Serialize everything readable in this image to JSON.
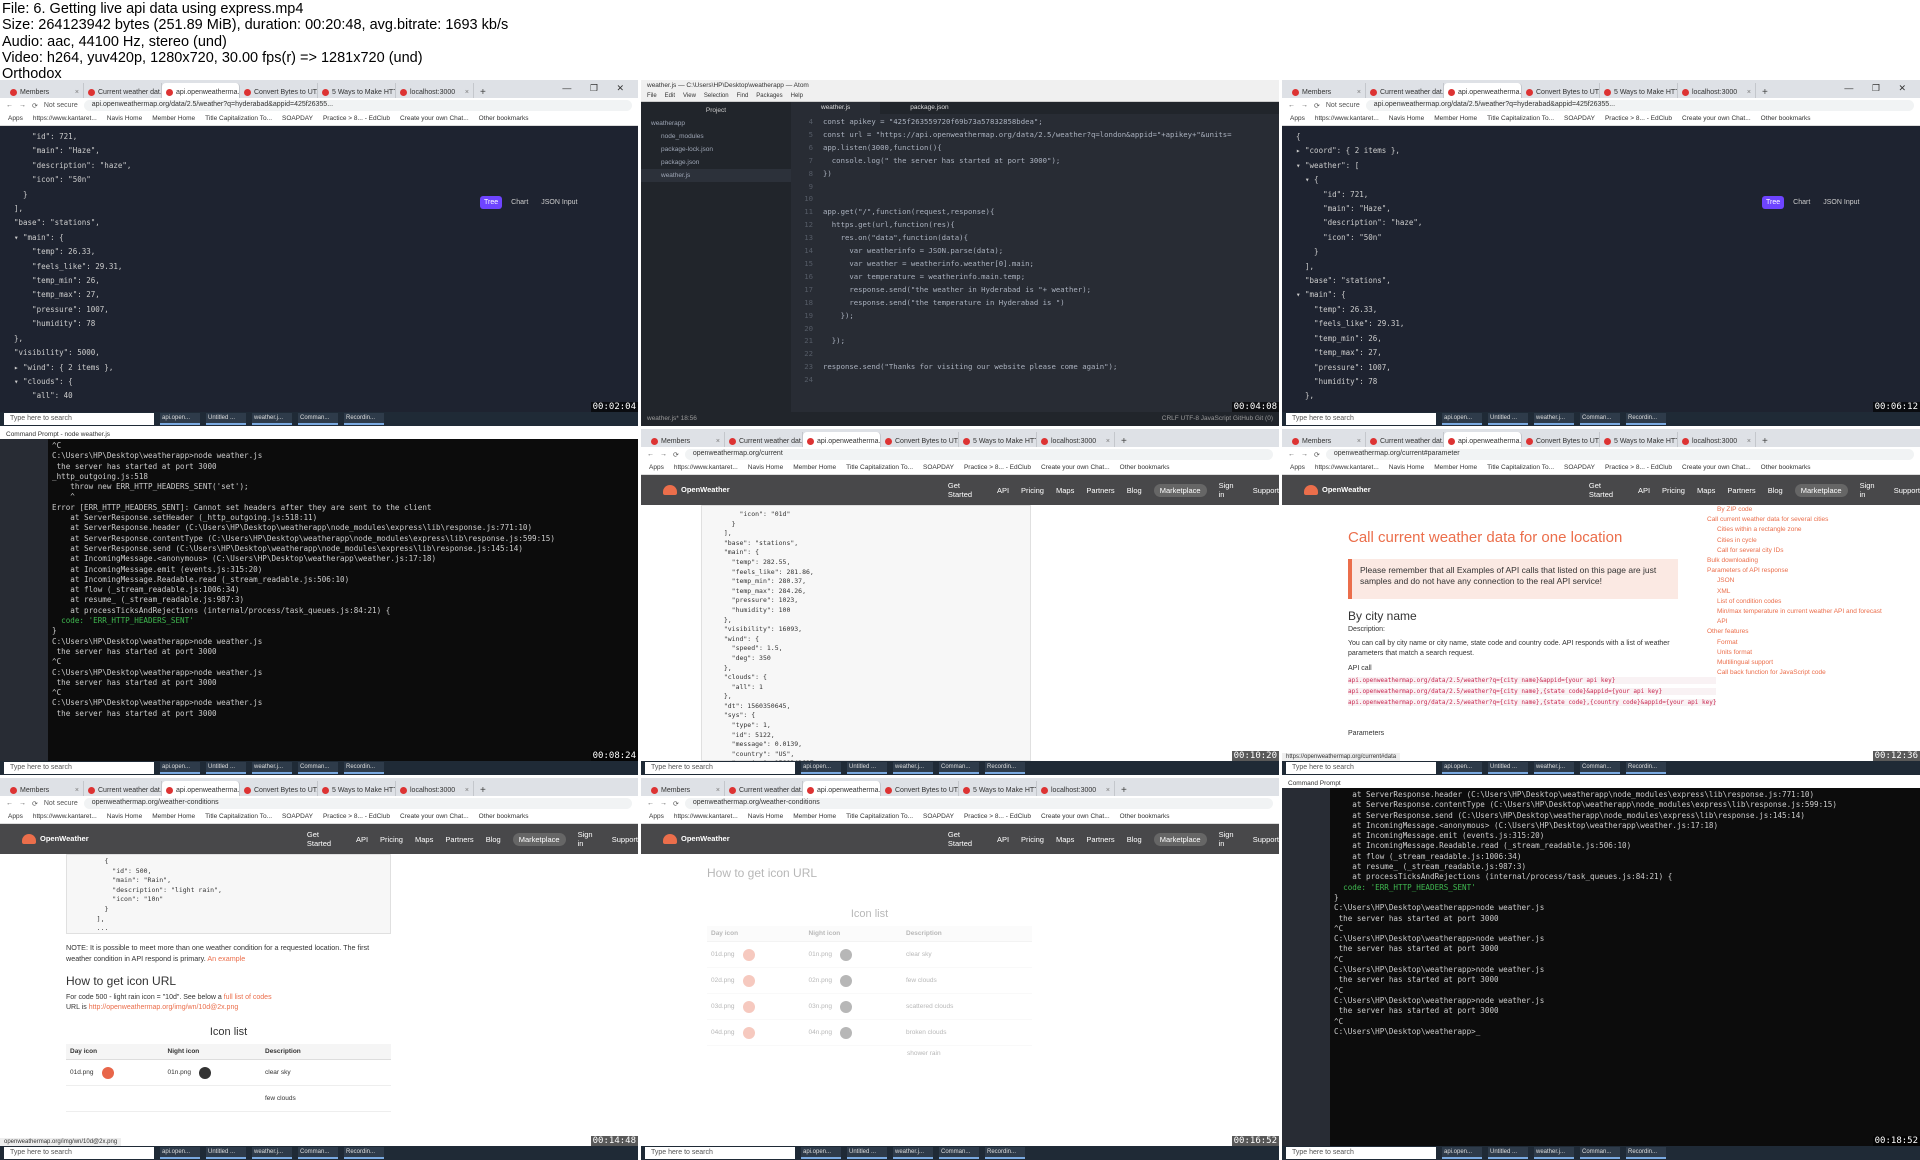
{
  "info": {
    "line1": "File: 6. Getting live api data using express.mp4",
    "line2": "Size: 264123942 bytes (251.89 MiB), duration: 00:20:48, avg.bitrate: 1693 kb/s",
    "line3": "Audio: aac, 44100 Hz, stereo (und)",
    "line4": "Video: h264, yuv420p, 1280x720, 30.00 fps(r) => 1281x720 (und)",
    "line5": "Orthodox"
  },
  "common": {
    "taskbar_search": "Type here to search",
    "bookmarks": [
      "Apps",
      "https://www.kantaret...",
      "Navis Home",
      "Member Home",
      "Title Capitalization To...",
      "SOAPDAY",
      "Practice > 8... - EdClub",
      "Create your own Chat...",
      "Other bookmarks"
    ],
    "not_secure": "Not secure",
    "window_controls": "— ❐ ✕",
    "json_buttons": [
      "Tree",
      "Chart",
      "JSON Input"
    ],
    "taskbar_apps": [
      "api.open...",
      "Untitled ...",
      "weather.j...",
      "Comman...",
      "Recordin..."
    ]
  },
  "frames": {
    "f1": {
      "tabs": [
        "Members",
        "Current weather dat...",
        "api.openweatherma...",
        "Convert Bytes to UT...",
        "5 Ways to Make HTT...",
        "localhost:3000"
      ],
      "url": "api.openweathermap.org/data/2.5/weather?q=hyderabad&appid=425f26355...",
      "timestamp": "00:02:04",
      "json": [
        "    \"id\": 721,",
        "    \"main\": \"Haze\",",
        "    \"description\": \"haze\",",
        "    \"icon\": \"50n\"",
        "  }",
        "],",
        "\"base\": \"stations\",",
        "▾ \"main\": {",
        "    \"temp\": 26.33,",
        "    \"feels_like\": 29.31,",
        "    \"temp_min\": 26,",
        "    \"temp_max\": 27,",
        "    \"pressure\": 1007,",
        "    \"humidity\": 78",
        "},",
        "\"visibility\": 5000,",
        "▸ \"wind\": { 2 items },",
        "▾ \"clouds\": {",
        "    \"all\": 40"
      ]
    },
    "f2": {
      "title": "weather.js — C:\\Users\\HP\\Desktop\\weatherapp — Atom",
      "menu": [
        "File",
        "Edit",
        "View",
        "Selection",
        "Find",
        "Packages",
        "Help"
      ],
      "project": "Project",
      "tree": [
        "weatherapp",
        "node_modules",
        "package-lock.json",
        "package.json",
        "weather.js"
      ],
      "tabs": [
        "weather.js",
        "package.json"
      ],
      "gutter": [
        "4",
        "5",
        "6",
        "7",
        "8",
        "9",
        "10",
        "11",
        "12",
        "13",
        "14",
        "15",
        "16",
        "17",
        "18",
        "19",
        "20",
        "21",
        "22",
        "23",
        "24"
      ],
      "code": [
        "const apikey = \"425f263559720f69b73a57832858bdea\";",
        "const url = \"https://api.openweathermap.org/data/2.5/weather?q=london&appid=\"+apikey+\"&units=",
        "app.listen(3000,function(){",
        "  console.log(\" the server has started at port 3000\");",
        "})",
        "",
        "",
        "app.get(\"/\",function(request,response){",
        "  https.get(url,function(res){",
        "    res.on(\"data\",function(data){",
        "      var weatherinfo = JSON.parse(data);",
        "      var weather = weatherinfo.weather[0].main;",
        "      var temperature = weatherinfo.main.temp;",
        "      response.send(\"the weather in Hyderabad is \"+ weather);",
        "      response.send(\"the temperature in Hyderabad is \")",
        "    });",
        "",
        "  });",
        "",
        "response.send(\"Thanks for visiting our website please come again\");",
        ""
      ],
      "status": "weather.js*   18:56",
      "status_right": "CRLF   UTF-8   JavaScript   GitHub   Git (0)",
      "timestamp": "00:04:08"
    },
    "f3": {
      "tabs": [
        "Members",
        "Current weather dat...",
        "api.openweatherma...",
        "Convert Bytes to UT...",
        "5 Ways to Make HTT...",
        "localhost:3000"
      ],
      "url": "api.openweathermap.org/data/2.5/weather?q=hyderabad&appid=425f26355...",
      "timestamp": "00:06:12",
      "json": [
        "{",
        "▸ \"coord\": { 2 items },",
        "▾ \"weather\": [",
        "  ▾ {",
        "      \"id\": 721,",
        "      \"main\": \"Haze\",",
        "      \"description\": \"haze\",",
        "      \"icon\": \"50n\"",
        "    }",
        "  ],",
        "  \"base\": \"stations\",",
        "▾ \"main\": {",
        "    \"temp\": 26.33,",
        "    \"feels_like\": 29.31,",
        "    \"temp_min\": 26,",
        "    \"temp_max\": 27,",
        "    \"pressure\": 1007,",
        "    \"humidity\": 78",
        "  },"
      ]
    },
    "f4": {
      "title": "Command Prompt - node  weather.js",
      "lines": [
        "^C",
        "C:\\Users\\HP\\Desktop\\weatherapp>node weather.js",
        " the server has started at port 3000",
        "_http_outgoing.js:518",
        "    throw new ERR_HTTP_HEADERS_SENT('set');",
        "    ^",
        "",
        "Error [ERR_HTTP_HEADERS_SENT]: Cannot set headers after they are sent to the client",
        "    at ServerResponse.setHeader (_http_outgoing.js:518:11)",
        "    at ServerResponse.header (C:\\Users\\HP\\Desktop\\weatherapp\\node_modules\\express\\lib\\response.js:771:10)",
        "    at ServerResponse.contentType (C:\\Users\\HP\\Desktop\\weatherapp\\node_modules\\express\\lib\\response.js:599:15)",
        "    at ServerResponse.send (C:\\Users\\HP\\Desktop\\weatherapp\\node_modules\\express\\lib\\response.js:145:14)",
        "    at IncomingMessage.<anonymous> (C:\\Users\\HP\\Desktop\\weatherapp\\weather.js:17:18)",
        "    at IncomingMessage.emit (events.js:315:20)",
        "    at IncomingMessage.Readable.read (_stream_readable.js:506:10)",
        "    at flow (_stream_readable.js:1006:34)",
        "    at resume_ (_stream_readable.js:987:3)",
        "    at processTicksAndRejections (internal/process/task_queues.js:84:21) {",
        "  code: 'ERR_HTTP_HEADERS_SENT'",
        "}",
        "",
        "C:\\Users\\HP\\Desktop\\weatherapp>node weather.js",
        " the server has started at port 3000",
        "^C",
        "C:\\Users\\HP\\Desktop\\weatherapp>node weather.js",
        " the server has started at port 3000",
        "^C",
        "C:\\Users\\HP\\Desktop\\weatherapp>node weather.js",
        " the server has started at port 3000"
      ],
      "timestamp": "00:08:24"
    },
    "f5": {
      "url": "openweathermap.org/current",
      "timestamp": "00:10:20",
      "json": [
        "      \"icon\": \"01d\"",
        "    }",
        "  ],",
        "  \"base\": \"stations\",",
        "  \"main\": {",
        "    \"temp\": 282.55,",
        "    \"feels_like\": 281.86,",
        "    \"temp_min\": 280.37,",
        "    \"temp_max\": 284.26,",
        "    \"pressure\": 1023,",
        "    \"humidity\": 100",
        "  },",
        "  \"visibility\": 16093,",
        "  \"wind\": {",
        "    \"speed\": 1.5,",
        "    \"deg\": 350",
        "  },",
        "  \"clouds\": {",
        "    \"all\": 1",
        "  },",
        "  \"dt\": 1560350645,",
        "  \"sys\": {",
        "    \"type\": 1,",
        "    \"id\": 5122,",
        "    \"message\": 0.0139,",
        "    \"country\": \"US\",",
        "    \"sunrise\": 1560343627,"
      ]
    },
    "f6": {
      "url": "openweathermap.org/current#parameter",
      "timestamp": "00:12:36",
      "heading": "Call current weather data for one location",
      "note": "Please remember that all Examples of API calls that listed on this page are just samples and do not have any connection to the real API service!",
      "by_city": "By city name",
      "description_label": "Description:",
      "description": "You can call by city name or city name, state code and country code. API responds with a list of weather parameters that match a search request.",
      "api_call": "API call",
      "calls": [
        "api.openweathermap.org/data/2.5/weather?q={city name}&appid={your api key}",
        "api.openweathermap.org/data/2.5/weather?q={city name},{state code}&appid={your api key}",
        "api.openweathermap.org/data/2.5/weather?q={city name},{state code},{country code}&appid={your api key}"
      ],
      "parameters": "Parameters",
      "side_links": [
        "By ZIP code",
        "Call current weather data for several cities",
        "Cities within a rectangle zone",
        "Cities in cycle",
        "Call for several city IDs",
        "Bulk downloading",
        "Parameters of API response",
        "JSON",
        "XML",
        "List of condition codes",
        "Min/max temperature in current weather API and forecast API",
        "Other features",
        "Format",
        "Units format",
        "Multilingual support",
        "Call back function for JavaScript code"
      ],
      "status_url": "https://openweathermap.org/current#data"
    },
    "f7": {
      "url": "openweathermap.org/weather-conditions",
      "timestamp": "00:14:48",
      "json": [
        "      {",
        "        \"id\": 500,",
        "        \"main\": \"Rain\",",
        "        \"description\": \"light rain\",",
        "        \"icon\": \"10n\"",
        "      }",
        "    ],",
        "    ..."
      ],
      "note": "NOTE: It is possible to meet more than one weather condition for a requested location. The first weather condition in API respond is primary.",
      "note_link": "An example",
      "heading": "How to get icon URL",
      "line1": "For code 500 - light rain icon = \"10d\". See below a",
      "line1_link": "full list of codes",
      "line2": "URL is",
      "line2_link": "http://openweathermap.org/img/wn/10d@2x.png",
      "icon_list": "Icon list",
      "cols": [
        "Day icon",
        "Night icon",
        "Description"
      ],
      "row1": [
        "01d.png",
        "01n.png",
        "clear sky"
      ],
      "row2": [
        "",
        "",
        "few clouds"
      ],
      "status_url": "openweathermap.org/img/wn/10d@2x.png"
    },
    "f8": {
      "url": "openweathermap.org/weather-conditions",
      "timestamp": "00:16:52",
      "heading": "How to get icon URL",
      "icon_list": "Icon list",
      "cols": [
        "Day icon",
        "Night icon",
        "Description"
      ],
      "rows": [
        [
          "01d.png",
          "01n.png",
          "clear sky"
        ],
        [
          "02d.png",
          "02n.png",
          "few clouds"
        ],
        [
          "03d.png",
          "03n.png",
          "scattered clouds"
        ],
        [
          "04d.png",
          "04n.png",
          "broken clouds"
        ]
      ],
      "next": "shower rain"
    },
    "f9": {
      "title": "Command Prompt",
      "lines": [
        "    at ServerResponse.header (C:\\Users\\HP\\Desktop\\weatherapp\\node_modules\\express\\lib\\response.js:771:10)",
        "    at ServerResponse.contentType (C:\\Users\\HP\\Desktop\\weatherapp\\node_modules\\express\\lib\\response.js:599:15)",
        "    at ServerResponse.send (C:\\Users\\HP\\Desktop\\weatherapp\\node_modules\\express\\lib\\response.js:145:14)",
        "    at IncomingMessage.<anonymous> (C:\\Users\\HP\\Desktop\\weatherapp\\weather.js:17:18)",
        "    at IncomingMessage.emit (events.js:315:20)",
        "    at IncomingMessage.Readable.read (_stream_readable.js:506:10)",
        "    at flow (_stream_readable.js:1006:34)",
        "    at resume_ (_stream_readable.js:987:3)",
        "    at processTicksAndRejections (internal/process/task_queues.js:84:21) {",
        "  code: 'ERR_HTTP_HEADERS_SENT'",
        "}",
        "",
        "C:\\Users\\HP\\Desktop\\weatherapp>node weather.js",
        " the server has started at port 3000",
        "^C",
        "C:\\Users\\HP\\Desktop\\weatherapp>node weather.js",
        " the server has started at port 3000",
        "^C",
        "C:\\Users\\HP\\Desktop\\weatherapp>node weather.js",
        " the server has started at port 3000",
        "^C",
        "C:\\Users\\HP\\Desktop\\weatherapp>node weather.js",
        " the server has started at port 3000",
        "^C",
        "C:\\Users\\HP\\Desktop\\weatherapp>_"
      ],
      "timestamp": "00:18:52"
    }
  }
}
